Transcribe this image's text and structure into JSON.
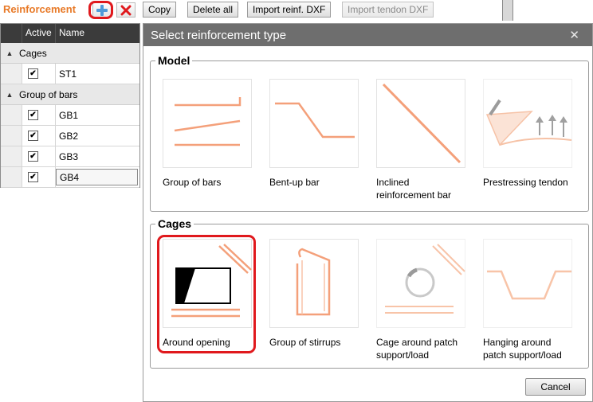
{
  "toolbar": {
    "title": "Reinforcement",
    "add_icon": "plus-icon",
    "delete_icon": "red-x-icon",
    "copy_label": "Copy",
    "delete_all_label": "Delete all",
    "import_reinf_label": "Import reinf. DXF",
    "import_tendon_label": "Import tendon DXF",
    "accent_color": "#e87a28",
    "highlight_color": "#e0191d"
  },
  "grid": {
    "col_active": "Active",
    "col_name": "Name",
    "groups": [
      {
        "label": "Cages",
        "items": [
          {
            "checked": "✔",
            "name": "ST1"
          }
        ]
      },
      {
        "label": "Group of bars",
        "items": [
          {
            "checked": "✔",
            "name": "GB1"
          },
          {
            "checked": "✔",
            "name": "GB2"
          },
          {
            "checked": "✔",
            "name": "GB3"
          },
          {
            "checked": "✔",
            "name": "GB4"
          }
        ]
      }
    ]
  },
  "dialog": {
    "title": "Select reinforcement type",
    "close_icon": "close-icon",
    "model_legend": "Model",
    "cages_legend": "Cages",
    "model_items": [
      {
        "label": "Group of bars",
        "icon": "group-of-bars-icon"
      },
      {
        "label": "Bent-up bar",
        "icon": "bent-up-bar-icon"
      },
      {
        "label": "Inclined\nreinforcement bar",
        "icon": "inclined-bar-icon"
      },
      {
        "label": "Prestressing tendon",
        "icon": "prestressing-tendon-icon"
      }
    ],
    "cage_items": [
      {
        "label": "Around opening",
        "icon": "around-opening-icon"
      },
      {
        "label": "Group of stirrups",
        "icon": "stirrups-icon"
      },
      {
        "label": "Cage around patch\nsupport/load",
        "icon": "cage-patch-icon"
      },
      {
        "label": "Hanging around\npatch support/load",
        "icon": "hanging-patch-icon"
      }
    ],
    "cancel_label": "Cancel",
    "bar_color": "#f4a07a"
  }
}
